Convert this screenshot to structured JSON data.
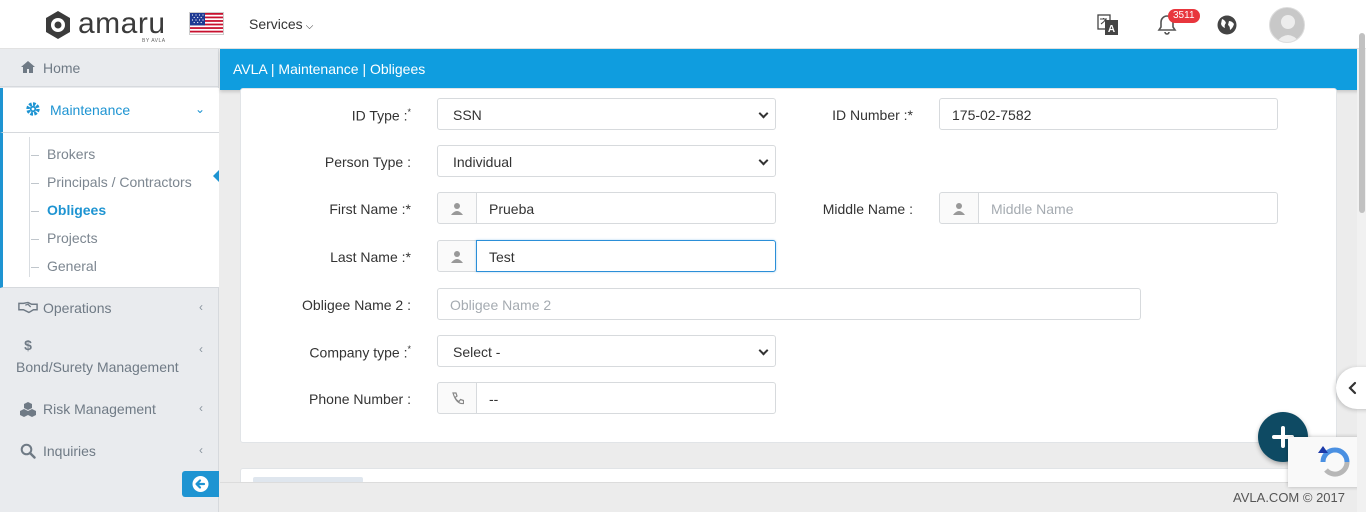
{
  "app": {
    "logo_text": "amaru",
    "logo_sub": "BY AVLA",
    "services_label": "Services",
    "notification_count": "3511"
  },
  "sidebar": {
    "home": "Home",
    "maintenance": "Maintenance",
    "submenu": [
      "Brokers",
      "Principals / Contractors",
      "Obligees",
      "Projects",
      "General"
    ],
    "active_submenu": "Obligees",
    "operations": "Operations",
    "bond_surety_icon": "$",
    "bond_surety": "Bond/Surety Management",
    "risk": "Risk Management",
    "inquiries": "Inquiries"
  },
  "breadcrumb": "AVLA | Maintenance | Obligees",
  "form": {
    "id_type_label": "ID Type :",
    "id_type_value": "SSN",
    "id_number_label": "ID Number :*",
    "id_number_value": "175-02-7582",
    "person_type_label": "Person Type :",
    "person_type_value": "Individual",
    "first_name_label": "First Name :*",
    "first_name_value": "Prueba",
    "middle_name_label": "Middle Name :",
    "middle_name_placeholder": "Middle Name",
    "last_name_label": "Last Name :*",
    "last_name_value": "Test",
    "obligee_name2_label": "Obligee Name 2 :",
    "obligee_name2_placeholder": "Obligee Name 2",
    "company_type_label": "Company type :",
    "company_type_value": "Select -",
    "phone_label": "Phone Number :",
    "phone_value": "--"
  },
  "footer": "AVLA.COM © 2017",
  "colors": {
    "accent": "#1e94d2",
    "breadcrumb_bg": "#0f9ddf",
    "fab": "#0e4a63",
    "badge": "#e8363d"
  },
  "icons": {
    "logo": "eye-logo-icon",
    "flag": "us-flag-icon",
    "translate": "translate-icon",
    "bell": "bell-icon",
    "globe": "globe-icon",
    "avatar": "user-avatar-icon",
    "user": "user-icon",
    "phone": "phone-icon",
    "fab": "plus-icon",
    "collapse": "arrow-left-circle-icon"
  }
}
